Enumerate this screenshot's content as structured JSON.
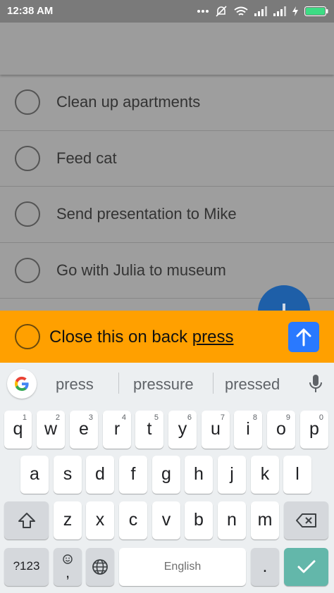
{
  "status_bar": {
    "time": "12:38 AM",
    "icons": [
      "more-dots-icon",
      "silent-mode-icon",
      "wifi-icon",
      "signal-icon",
      "signal-icon",
      "charging-icon",
      "battery-icon"
    ]
  },
  "todo_list": {
    "items": [
      {
        "label": "Clean up apartments",
        "checked": false
      },
      {
        "label": "Feed cat",
        "checked": false
      },
      {
        "label": "Send presentation to Mike",
        "checked": false
      },
      {
        "label": "Go with Julia to museum",
        "checked": false
      }
    ]
  },
  "composer": {
    "text_before": "Close this on back ",
    "text_underlined": "press",
    "send_icon": "arrow-up-icon"
  },
  "keyboard": {
    "suggestions": [
      "press",
      "pressure",
      "pressed"
    ],
    "row1": [
      {
        "key": "q",
        "hint": "1"
      },
      {
        "key": "w",
        "hint": "2"
      },
      {
        "key": "e",
        "hint": "3"
      },
      {
        "key": "r",
        "hint": "4"
      },
      {
        "key": "t",
        "hint": "5"
      },
      {
        "key": "y",
        "hint": "6"
      },
      {
        "key": "u",
        "hint": "7"
      },
      {
        "key": "i",
        "hint": "8"
      },
      {
        "key": "o",
        "hint": "9"
      },
      {
        "key": "p",
        "hint": "0"
      }
    ],
    "row2": [
      "a",
      "s",
      "d",
      "f",
      "g",
      "h",
      "j",
      "k",
      "l"
    ],
    "row3": [
      "z",
      "x",
      "c",
      "v",
      "b",
      "n",
      "m"
    ],
    "symbols_label": "?123",
    "emoji_comma": ",",
    "space_label": "English",
    "period_label": ".",
    "colors": {
      "accent": "#ffa000",
      "send": "#2979ff",
      "enter": "#63b7aa",
      "fab": "#1e5fa8"
    }
  }
}
